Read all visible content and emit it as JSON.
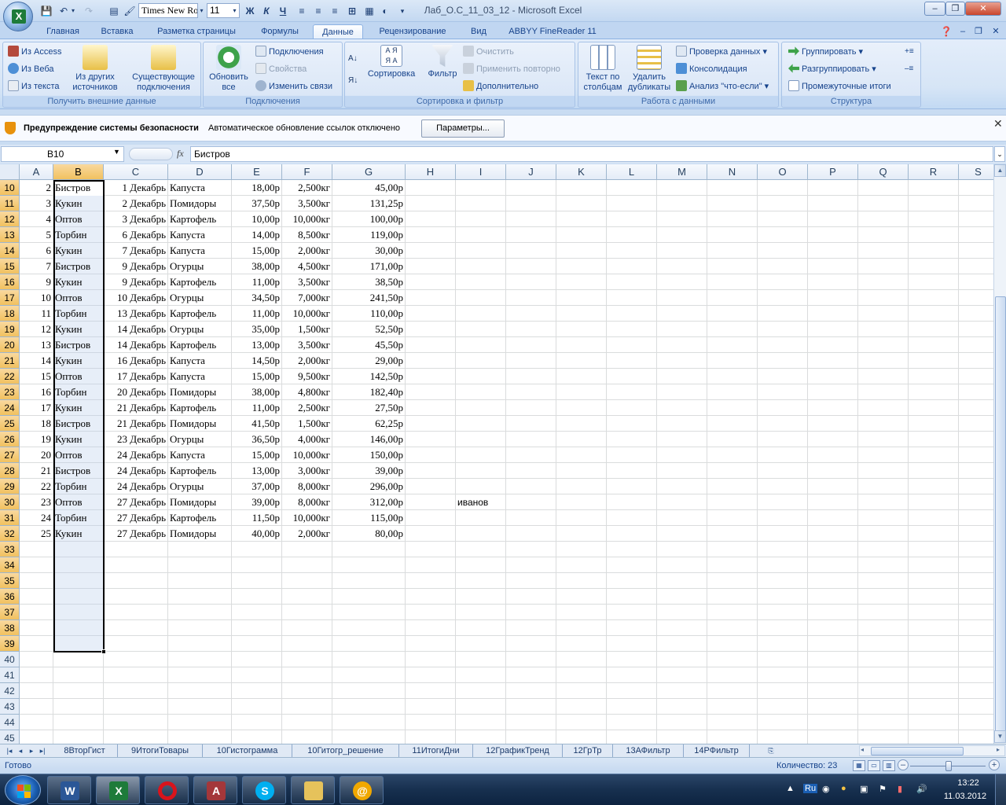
{
  "window": {
    "title": "Лаб_О.С_11_03_12 - Microsoft Excel",
    "font_name": "Times New Rom",
    "font_size": "11"
  },
  "tabs": [
    "Главная",
    "Вставка",
    "Разметка страницы",
    "Формулы",
    "Данные",
    "Рецензирование",
    "Вид",
    "ABBYY FineReader 11"
  ],
  "active_tab": "Данные",
  "ribbon": {
    "external": {
      "from_access": "Из Access",
      "from_web": "Из Веба",
      "from_text": "Из текста",
      "other_l1": "Из других",
      "other_l2": "источников",
      "existing_l1": "Существующие",
      "existing_l2": "подключения",
      "label": "Получить внешние данные"
    },
    "connections": {
      "refresh_l1": "Обновить",
      "refresh_l2": "все",
      "connections": "Подключения",
      "properties": "Свойства",
      "edit_links": "Изменить связи",
      "label": "Подключения"
    },
    "sort": {
      "sort": "Сортировка",
      "filter": "Фильтр",
      "clear": "Очистить",
      "reapply": "Применить повторно",
      "advanced": "Дополнительно",
      "label": "Сортировка и фильтр"
    },
    "data_tools": {
      "text_l1": "Текст по",
      "text_l2": "столбцам",
      "dup_l1": "Удалить",
      "dup_l2": "дубликаты",
      "validation": "Проверка данных",
      "consolidate": "Консолидация",
      "whatif": "Анализ \"что-если\"",
      "label": "Работа с данными"
    },
    "outline": {
      "group": "Группировать",
      "ungroup": "Разгруппировать",
      "subtotal": "Промежуточные итоги",
      "label": "Структура"
    }
  },
  "security": {
    "title": "Предупреждение системы безопасности",
    "message": "Автоматическое обновление ссылок отключено",
    "button": "Параметры..."
  },
  "formula_bar": {
    "name_box": "B10",
    "content": "Бистров",
    "fx": "fx"
  },
  "columns": [
    "A",
    "B",
    "C",
    "D",
    "E",
    "F",
    "G",
    "H",
    "I",
    "J",
    "K",
    "L",
    "M",
    "N",
    "O",
    "P",
    "Q",
    "R",
    "S"
  ],
  "rows": [
    {
      "n": "10",
      "a": "2",
      "b": "Бистров",
      "c": "1 Декабрь",
      "d": "Капуста",
      "e": "18,00р",
      "f": "2,500кг",
      "g": "45,00р"
    },
    {
      "n": "11",
      "a": "3",
      "b": "Кукин",
      "c": "2 Декабрь",
      "d": "Помидоры",
      "e": "37,50р",
      "f": "3,500кг",
      "g": "131,25р"
    },
    {
      "n": "12",
      "a": "4",
      "b": "Оптов",
      "c": "3 Декабрь",
      "d": "Картофель",
      "e": "10,00р",
      "f": "10,000кг",
      "g": "100,00р"
    },
    {
      "n": "13",
      "a": "5",
      "b": "Торбин",
      "c": "6 Декабрь",
      "d": "Капуста",
      "e": "14,00р",
      "f": "8,500кг",
      "g": "119,00р"
    },
    {
      "n": "14",
      "a": "6",
      "b": "Кукин",
      "c": "7 Декабрь",
      "d": "Капуста",
      "e": "15,00р",
      "f": "2,000кг",
      "g": "30,00р"
    },
    {
      "n": "15",
      "a": "7",
      "b": "Бистров",
      "c": "9 Декабрь",
      "d": "Огурцы",
      "e": "38,00р",
      "f": "4,500кг",
      "g": "171,00р"
    },
    {
      "n": "16",
      "a": "9",
      "b": "Кукин",
      "c": "9 Декабрь",
      "d": "Картофель",
      "e": "11,00р",
      "f": "3,500кг",
      "g": "38,50р"
    },
    {
      "n": "17",
      "a": "10",
      "b": "Оптов",
      "c": "10 Декабрь",
      "d": "Огурцы",
      "e": "34,50р",
      "f": "7,000кг",
      "g": "241,50р"
    },
    {
      "n": "18",
      "a": "11",
      "b": "Торбин",
      "c": "13 Декабрь",
      "d": "Картофель",
      "e": "11,00р",
      "f": "10,000кг",
      "g": "110,00р"
    },
    {
      "n": "19",
      "a": "12",
      "b": "Кукин",
      "c": "14 Декабрь",
      "d": "Огурцы",
      "e": "35,00р",
      "f": "1,500кг",
      "g": "52,50р"
    },
    {
      "n": "20",
      "a": "13",
      "b": "Бистров",
      "c": "14 Декабрь",
      "d": "Картофель",
      "e": "13,00р",
      "f": "3,500кг",
      "g": "45,50р"
    },
    {
      "n": "21",
      "a": "14",
      "b": "Кукин",
      "c": "16 Декабрь",
      "d": "Капуста",
      "e": "14,50р",
      "f": "2,000кг",
      "g": "29,00р"
    },
    {
      "n": "22",
      "a": "15",
      "b": "Оптов",
      "c": "17 Декабрь",
      "d": "Капуста",
      "e": "15,00р",
      "f": "9,500кг",
      "g": "142,50р"
    },
    {
      "n": "23",
      "a": "16",
      "b": "Торбин",
      "c": "20 Декабрь",
      "d": "Помидоры",
      "e": "38,00р",
      "f": "4,800кг",
      "g": "182,40р"
    },
    {
      "n": "24",
      "a": "17",
      "b": "Кукин",
      "c": "21 Декабрь",
      "d": "Картофель",
      "e": "11,00р",
      "f": "2,500кг",
      "g": "27,50р"
    },
    {
      "n": "25",
      "a": "18",
      "b": "Бистров",
      "c": "21 Декабрь",
      "d": "Помидоры",
      "e": "41,50р",
      "f": "1,500кг",
      "g": "62,25р"
    },
    {
      "n": "26",
      "a": "19",
      "b": "Кукин",
      "c": "23 Декабрь",
      "d": "Огурцы",
      "e": "36,50р",
      "f": "4,000кг",
      "g": "146,00р"
    },
    {
      "n": "27",
      "a": "20",
      "b": "Оптов",
      "c": "24 Декабрь",
      "d": "Капуста",
      "e": "15,00р",
      "f": "10,000кг",
      "g": "150,00р"
    },
    {
      "n": "28",
      "a": "21",
      "b": "Бистров",
      "c": "24 Декабрь",
      "d": "Картофель",
      "e": "13,00р",
      "f": "3,000кг",
      "g": "39,00р"
    },
    {
      "n": "29",
      "a": "22",
      "b": "Торбин",
      "c": "24 Декабрь",
      "d": "Огурцы",
      "e": "37,00р",
      "f": "8,000кг",
      "g": "296,00р"
    },
    {
      "n": "30",
      "a": "23",
      "b": "Оптов",
      "c": "27 Декабрь",
      "d": "Помидоры",
      "e": "39,00р",
      "f": "8,000кг",
      "g": "312,00р",
      "i": "иванов"
    },
    {
      "n": "31",
      "a": "24",
      "b": "Торбин",
      "c": "27 Декабрь",
      "d": "Картофель",
      "e": "11,50р",
      "f": "10,000кг",
      "g": "115,00р"
    },
    {
      "n": "32",
      "a": "25",
      "b": "Кукин",
      "c": "27 Декабрь",
      "d": "Помидоры",
      "e": "40,00р",
      "f": "2,000кг",
      "g": "80,00р"
    },
    {
      "n": "33"
    },
    {
      "n": "34"
    },
    {
      "n": "35"
    },
    {
      "n": "36"
    },
    {
      "n": "37"
    },
    {
      "n": "38"
    },
    {
      "n": "39"
    },
    {
      "n": "40"
    },
    {
      "n": "41"
    },
    {
      "n": "42"
    },
    {
      "n": "43"
    },
    {
      "n": "44"
    },
    {
      "n": "45"
    }
  ],
  "sheet_tabs": [
    "8ВторГист",
    "9ИтогиТовары",
    "10Гистограмма",
    "10Гитогр_решение",
    "11ИтогиДни",
    "12ГрафикТренд",
    "12ГрТр",
    "13АФильтр",
    "14РФильтр"
  ],
  "status": {
    "ready": "Готово",
    "count": "Количество: 23"
  },
  "taskbar": {
    "lang": "Ru",
    "time": "13:22",
    "date": "11.03.2012"
  },
  "colors": {
    "ribbon_bg": "#d6e5f6",
    "selection_header": "#f1c15f",
    "excel_green": "#1e7b3a"
  }
}
